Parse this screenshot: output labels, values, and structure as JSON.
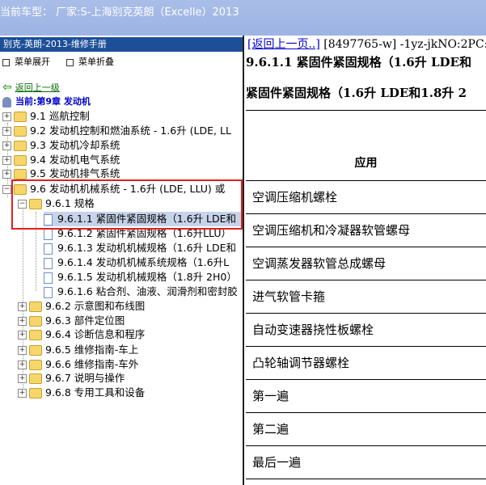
{
  "top_bar": {
    "text": "当前车型：  厂家:S-上海别克英朗（Excelle）2013"
  },
  "left_panel": {
    "header": "别克-英朗-2013-维修手册",
    "menu_expand": "菜单展开",
    "menu_collapse": "菜单折叠",
    "back_link": "返回上一级",
    "current": "当前:第9章 发动机",
    "tree": [
      {
        "label": "9.1 巡航控制"
      },
      {
        "label": "9.2 发动机控制和燃油系统 - 1.6升 (LDE, LL"
      },
      {
        "label": "9.3 发动机冷却系统"
      },
      {
        "label": "9.4 发动机电气系统"
      },
      {
        "label": "9.5 发动机排气系统"
      },
      {
        "label": "9.6 发动机机械系统 - 1.6升 (LDE, LLU) 或"
      },
      {
        "label": "9.6.1 规格"
      },
      {
        "label": "9.6.1.1 紧固件紧固规格（1.6升 LDE和"
      },
      {
        "label": "9.6.1.2 紧固件紧固规格（1.6升LLU）"
      },
      {
        "label": "9.6.1.3 发动机机械规格（1.6升 LDE和"
      },
      {
        "label": "9.6.1.4 发动机机械系统规格（1.6升L"
      },
      {
        "label": "9.6.1.5 发动机机械规格（1.8升 2H0）"
      },
      {
        "label": "9.6.1.6 粘合剂、油液、润滑剂和密封胶"
      },
      {
        "label": "9.6.2 示意图和布线图"
      },
      {
        "label": "9.6.3 部件定位图"
      },
      {
        "label": "9.6.4 诊断信息和程序"
      },
      {
        "label": "9.6.5 维修指南-车上"
      },
      {
        "label": "9.6.6 维修指南-车外"
      },
      {
        "label": "9.6.7 说明与操作"
      },
      {
        "label": "9.6.8 专用工具和设备"
      }
    ]
  },
  "right_panel": {
    "nav_link": "[返回上一页..]",
    "nav_text": " [8497765-w] -1yz-jkNO:2PC:",
    "title1": "9.6.1.1 紧固件紧固规格（1.6升 LDE和",
    "title2": "紧固件紧固规格（1.6升 LDE和1.8升 2",
    "table_header": "应用",
    "rows": [
      "空调压缩机螺栓",
      "空调压缩机和冷凝器软管螺母",
      "空调蒸发器软管总成螺母",
      "进气软管卡箍",
      "自动变速器挠性板螺栓",
      "凸轮轴调节器螺栓",
      "第一遍",
      "第二遍",
      "最后一遍"
    ]
  }
}
